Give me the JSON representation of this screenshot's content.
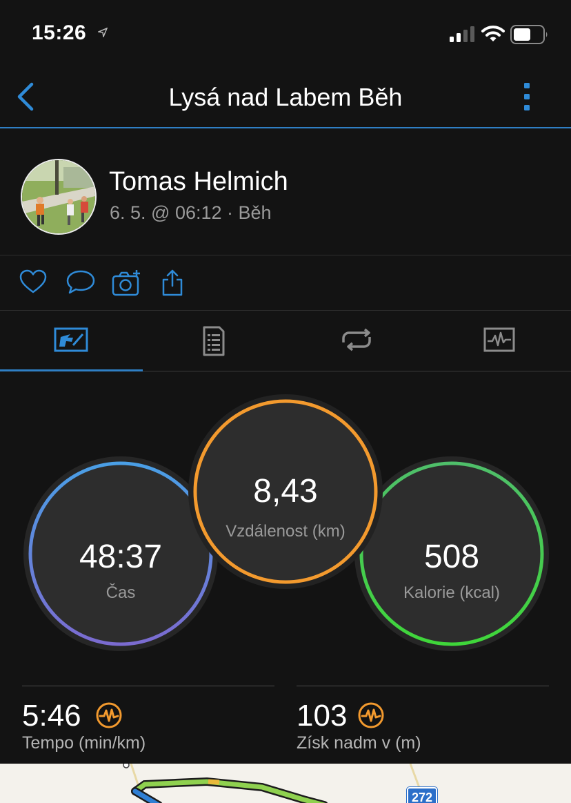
{
  "status": {
    "time": "15:26"
  },
  "nav": {
    "title": "Lysá nad Labem Běh"
  },
  "profile": {
    "name": "Tomas Helmich",
    "meta": "6. 5. @ 06:12 · Běh"
  },
  "actions": [
    "heart-icon",
    "comment-icon",
    "add-photo-icon",
    "share-icon"
  ],
  "tabs": [
    "overview",
    "details",
    "laps",
    "charts"
  ],
  "rings": {
    "time": {
      "value": "48:37",
      "label": "Čas",
      "color_top": "#4a9fe6",
      "color_bottom": "#7b6bd0"
    },
    "distance": {
      "value": "8,43",
      "label": "Vzdálenost (km)",
      "color": "#f39a2e"
    },
    "calories": {
      "value": "508",
      "label": "Kalorie (kcal)",
      "color_top": "#4fbf6a",
      "color_bottom": "#3fd63a"
    }
  },
  "stats": [
    {
      "value": "5:46",
      "label": "Tempo (min/km)",
      "icon": "pulse-icon",
      "icon_color": "#f39a2e"
    },
    {
      "value": "103",
      "label": "Získ nadm v (m)",
      "icon": "pulse-icon",
      "icon_color": "#f39a2e"
    }
  ],
  "map": {
    "road_number": "272"
  }
}
